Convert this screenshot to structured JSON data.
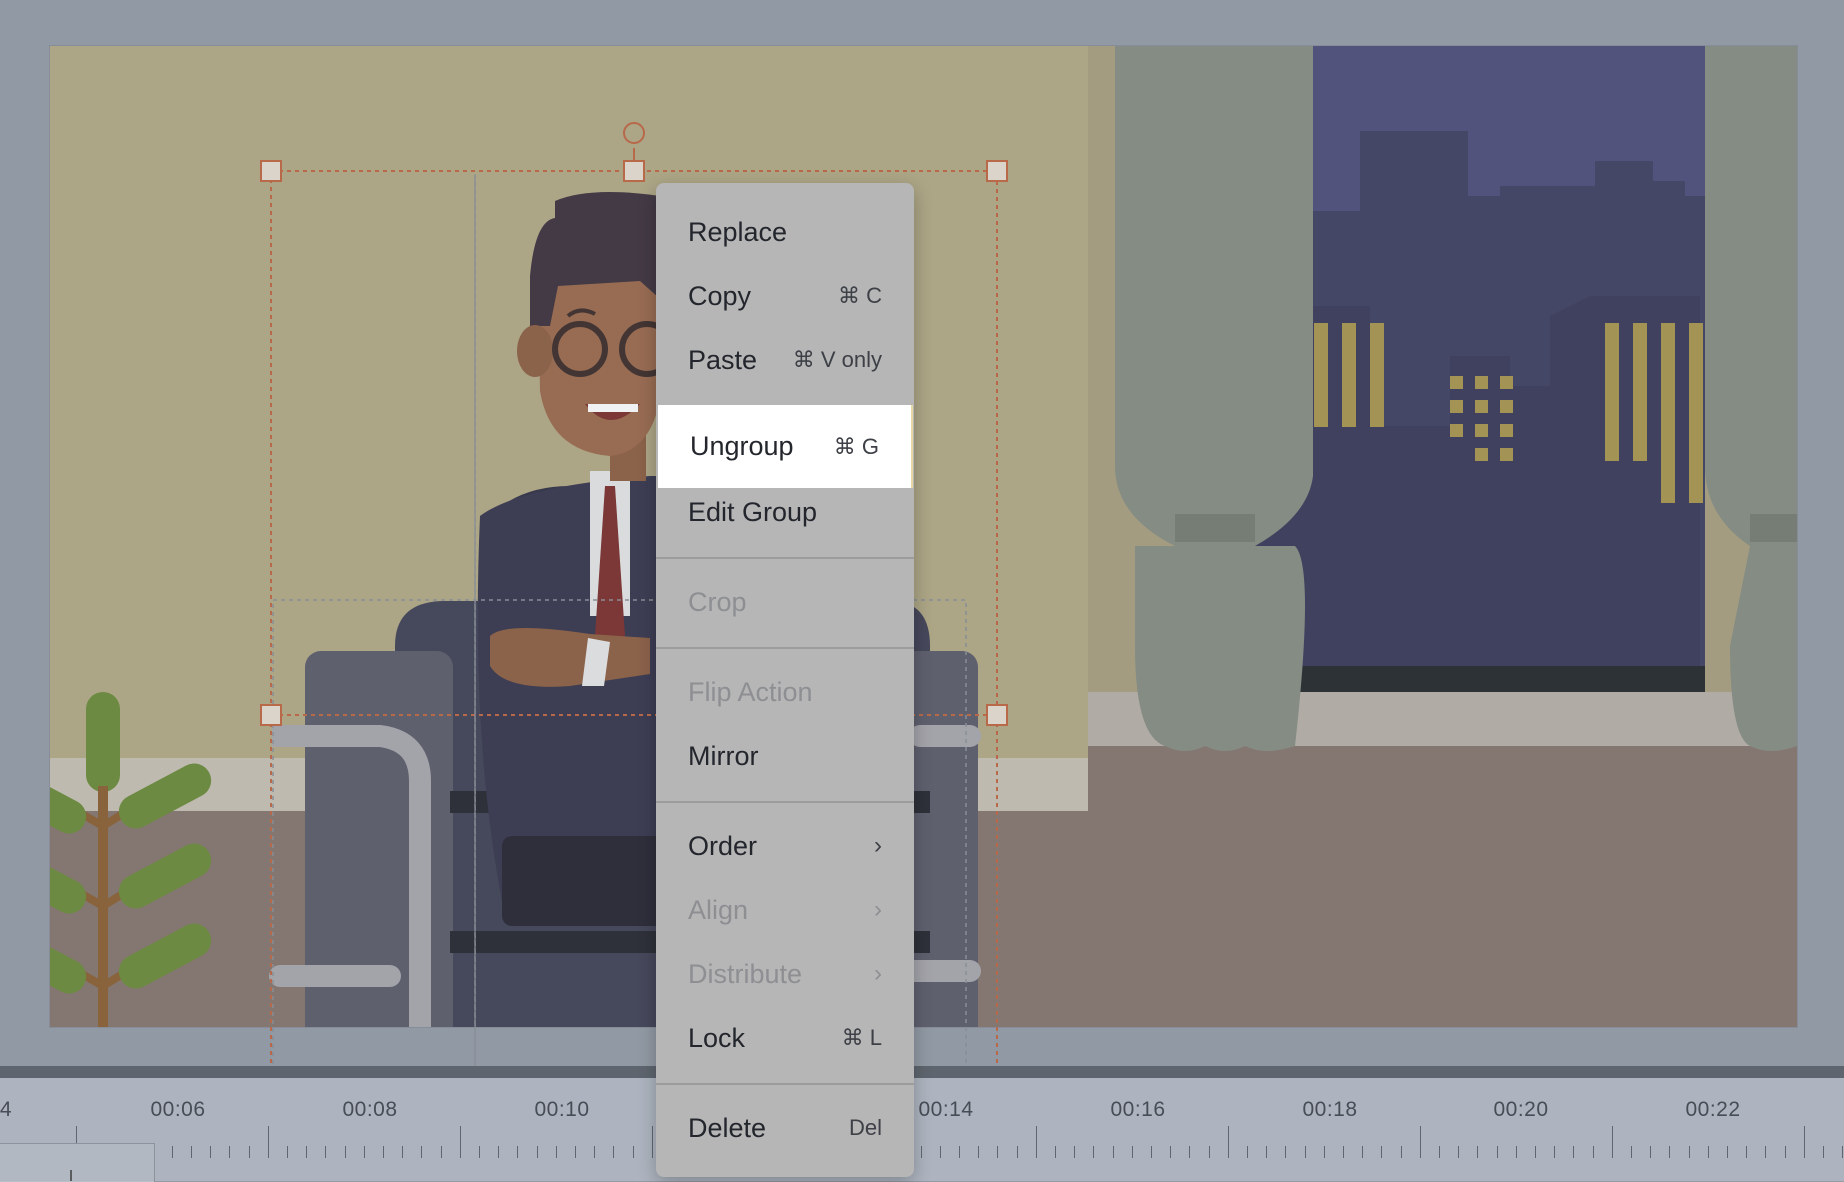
{
  "context_menu": {
    "items": [
      {
        "label": "Replace",
        "shortcut": "",
        "enabled": true
      },
      {
        "label": "Copy",
        "shortcut": "⌘ C",
        "enabled": true
      },
      {
        "label": "Paste",
        "shortcut": "⌘ V only",
        "enabled": true
      },
      {
        "label": "Ungroup",
        "shortcut": "⌘ G",
        "enabled": true,
        "highlighted": true
      },
      {
        "label": "Edit Group",
        "shortcut": "",
        "enabled": true
      },
      {
        "label": "Crop",
        "shortcut": "",
        "enabled": false
      },
      {
        "label": "Flip Action",
        "shortcut": "",
        "enabled": false
      },
      {
        "label": "Mirror",
        "shortcut": "",
        "enabled": true
      },
      {
        "label": "Order",
        "submenu": true,
        "enabled": true
      },
      {
        "label": "Align",
        "submenu": true,
        "enabled": false
      },
      {
        "label": "Distribute",
        "submenu": true,
        "enabled": false
      },
      {
        "label": "Lock",
        "shortcut": "⌘ L",
        "enabled": true
      },
      {
        "label": "Delete",
        "shortcut": "Del",
        "enabled": true
      }
    ],
    "chevron": "›"
  },
  "timeline": {
    "labels": [
      "4",
      "00:06",
      "00:08",
      "00:10",
      "00:14",
      "00:16",
      "00:18",
      "00:20",
      "00:22"
    ]
  },
  "colors": {
    "wall": "#b2a983",
    "floor": "#85736b",
    "night_sky": "#4b4c78",
    "curtain": "#858c80",
    "selection": "#c0653f",
    "menu_bg": "#b6b6b6",
    "highlight_bg": "#ffffff"
  }
}
